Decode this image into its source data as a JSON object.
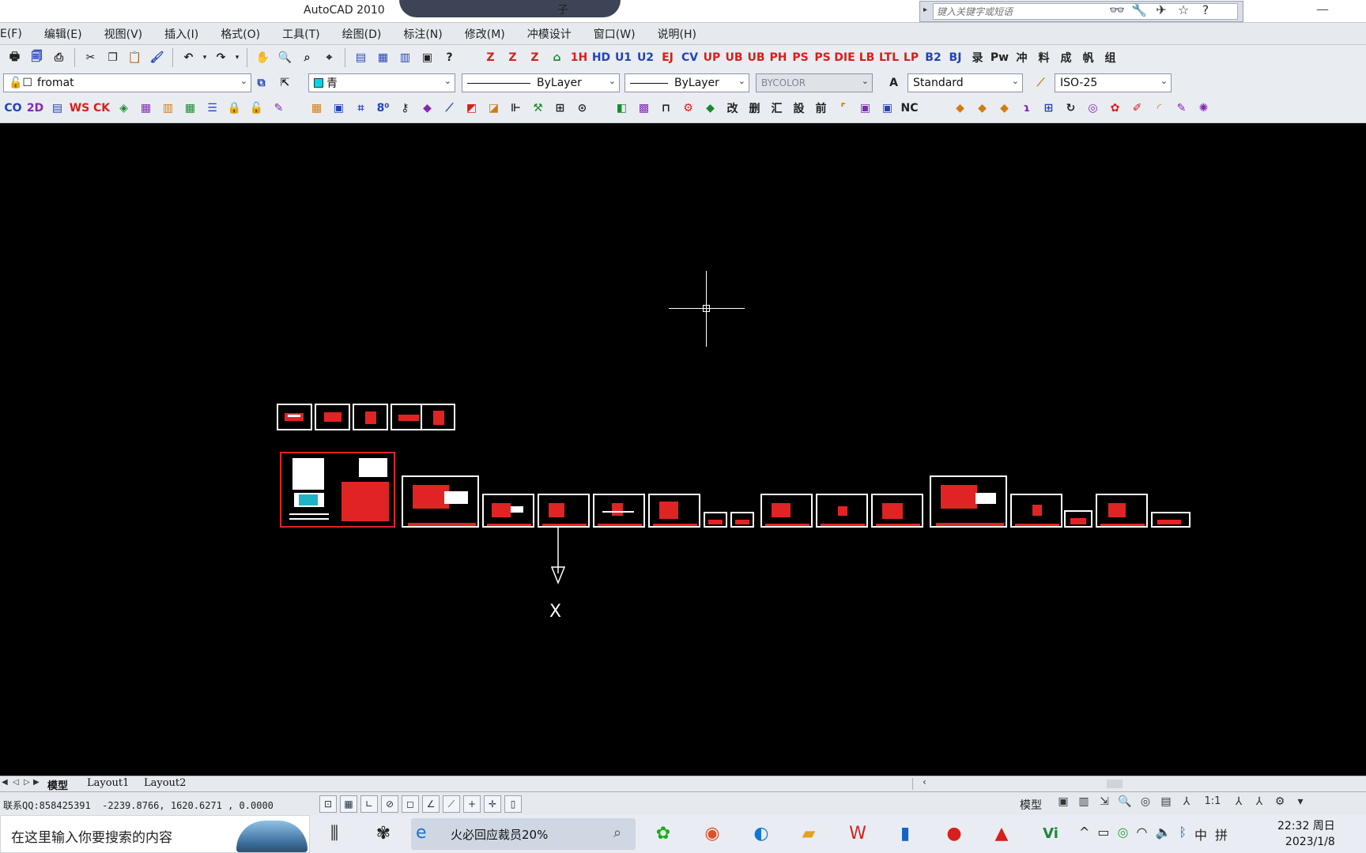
{
  "window": {
    "title": "AutoCAD 2010",
    "title_suffix": "子",
    "search_placeholder": "键入关键字或短语",
    "search_tools": [
      "binoculars-icon",
      "wrench-icon",
      "satellite-icon",
      "star-icon",
      "help-icon"
    ]
  },
  "menu": [
    "E(F)",
    "编辑(E)",
    "视图(V)",
    "插入(I)",
    "格式(O)",
    "工具(T)",
    "绘图(D)",
    "标注(N)",
    "修改(M)",
    "冲模设计",
    "窗口(W)",
    "说明(H)"
  ],
  "toolbar_row2": {
    "layer_value": "fromat",
    "color_value": "青",
    "linetype_value": "ByLayer",
    "lineweight_value": "ByLayer",
    "plotstyle_value": "BYCOLOR",
    "textstyle_value": "Standard",
    "dimstyle_value": "ISO-25"
  },
  "toolbar_row1_custom_labels": [
    "Z",
    "Z",
    "Z",
    "HD",
    "U1",
    "U2",
    "EJ",
    "CV",
    "UP",
    "UB",
    "PH",
    "PS",
    "DIE",
    "LB",
    "LTL",
    "LP",
    "B2",
    "BJ",
    "冲",
    "料",
    "成",
    "帆",
    "组"
  ],
  "toolbar_row3_labels": [
    "CO",
    "2D",
    "WS",
    "CK",
    "改",
    "删",
    "汇",
    "設",
    "前",
    "NC"
  ],
  "layout_tabs": [
    "模型",
    "Layout1",
    "Layout2"
  ],
  "status": {
    "coords_prefix": "联系QQ:858425391",
    "coords": "-2239.8766, 1620.6271 , 0.0000",
    "model_label": "模型",
    "scale": "1:1"
  },
  "taskbar": {
    "search_placeholder": "在这里输入你要搜索的内容",
    "active_app": "火必回应裁员20%",
    "time": "22:32 周日",
    "date": "2023/1/8",
    "ime": "中",
    "ime2": "拼"
  },
  "canvas": {
    "ucs_label": "X"
  }
}
